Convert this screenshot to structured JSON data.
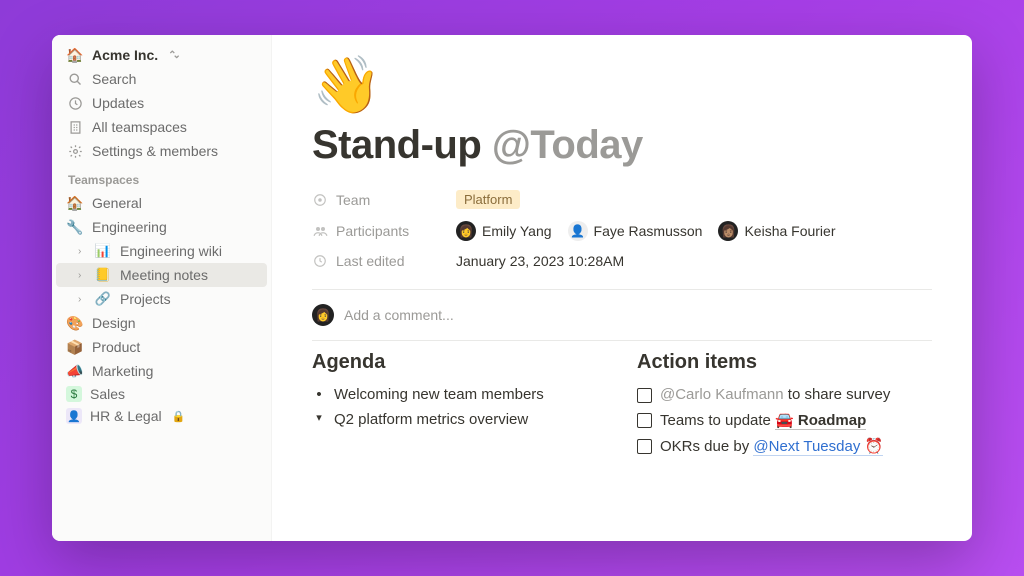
{
  "sidebar": {
    "workspace_name": "Acme Inc.",
    "nav": {
      "search": "Search",
      "updates": "Updates",
      "teamspaces": "All teamspaces",
      "settings": "Settings & members"
    },
    "teamspaces_label": "Teamspaces",
    "teamspaces": [
      {
        "icon": "🏠",
        "label": "General"
      },
      {
        "icon": "🔧",
        "label": "Engineering"
      },
      {
        "icon": "🎨",
        "label": "Design",
        "icon_alt": "palette"
      },
      {
        "icon": "📦",
        "label": "Product"
      },
      {
        "icon": "📣",
        "label": "Marketing"
      },
      {
        "icon": "💲",
        "label": "Sales"
      },
      {
        "icon": "👤",
        "label": "HR & Legal",
        "locked": true
      }
    ],
    "engineering_children": [
      {
        "icon": "📊",
        "label": "Engineering wiki"
      },
      {
        "icon": "📒",
        "label": "Meeting notes",
        "selected": true
      },
      {
        "icon": "🔗",
        "label": "Projects"
      }
    ]
  },
  "page": {
    "icon": "👋",
    "title_main": "Stand-up ",
    "title_mention": "@Today",
    "props": {
      "team_label": "Team",
      "team_value": "Platform",
      "participants_label": "Participants",
      "participants": [
        {
          "name": "Emily Yang"
        },
        {
          "name": "Faye Rasmusson"
        },
        {
          "name": "Keisha Fourier"
        }
      ],
      "last_edited_label": "Last edited",
      "last_edited_value": "January 23, 2023 10:28AM"
    },
    "comment_placeholder": "Add a comment...",
    "agenda": {
      "heading": "Agenda",
      "items": [
        {
          "marker": "•",
          "text": "Welcoming new team members"
        },
        {
          "marker": "▾",
          "text": "Q2 platform metrics overview"
        }
      ]
    },
    "action_items": {
      "heading": "Action items",
      "items": [
        {
          "prefix_mention": "@Carlo Kaufmann",
          "rest": " to share survey"
        },
        {
          "text_before": "Teams to update ",
          "link_icon": "🚘",
          "link_text": " Roadmap"
        },
        {
          "text_before": "OKRs due by ",
          "date_mention": "@Next Tuesday",
          "suffix_icon": "⏰"
        }
      ]
    }
  }
}
